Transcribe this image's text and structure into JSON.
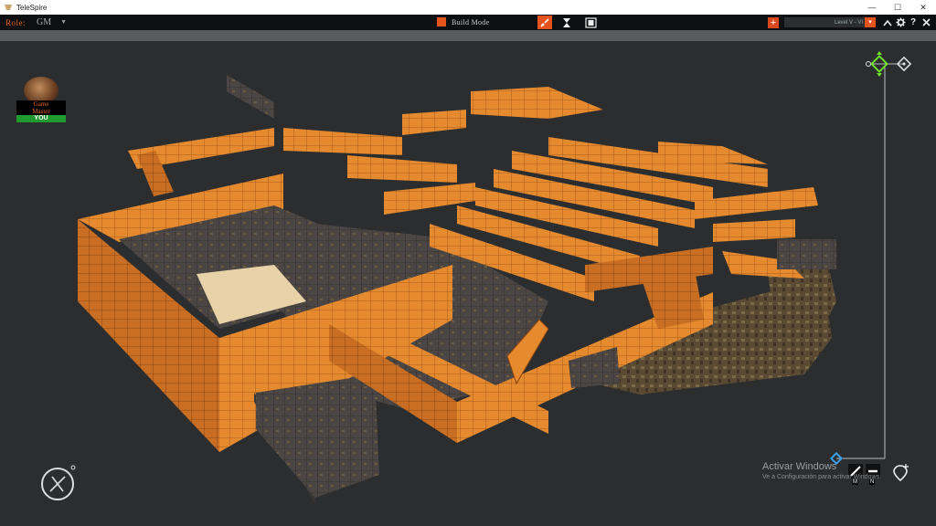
{
  "window": {
    "title": "TeleSpire",
    "minimize": "—",
    "maximize": "☐",
    "close": "✕"
  },
  "toolbar": {
    "role_label": "Role:",
    "user": "GM",
    "caret": "▼",
    "mode_label": "Build Mode",
    "level_label": "Level V - VI",
    "level_arrow": "▾",
    "plus": "+",
    "help": "?"
  },
  "avatar": {
    "name_line1": "Game",
    "name_line2": "Master",
    "you": "YOU"
  },
  "axis": {
    "m_label": "M",
    "n_label": "N"
  },
  "watermark": {
    "line1": "Activar Windows",
    "line2": "Ve a Configuración para activar Windows."
  },
  "colors": {
    "accent": "#e3541c",
    "wall": "#e58a2e",
    "wall_dark": "#a95a1c",
    "stone": "#4a4542",
    "floor": "#e8d2a8",
    "green_handle": "#6ee02a",
    "blue_handle": "#3a9ee8"
  },
  "icons": [
    "app-icon",
    "brush-icon",
    "hourglass-icon",
    "film-icon",
    "plus-icon",
    "chevron-up-icon",
    "gear-icon",
    "help-icon",
    "compass-icon",
    "axis-handle-icon",
    "pen-icon",
    "minus-icon",
    "add-pin-icon"
  ]
}
